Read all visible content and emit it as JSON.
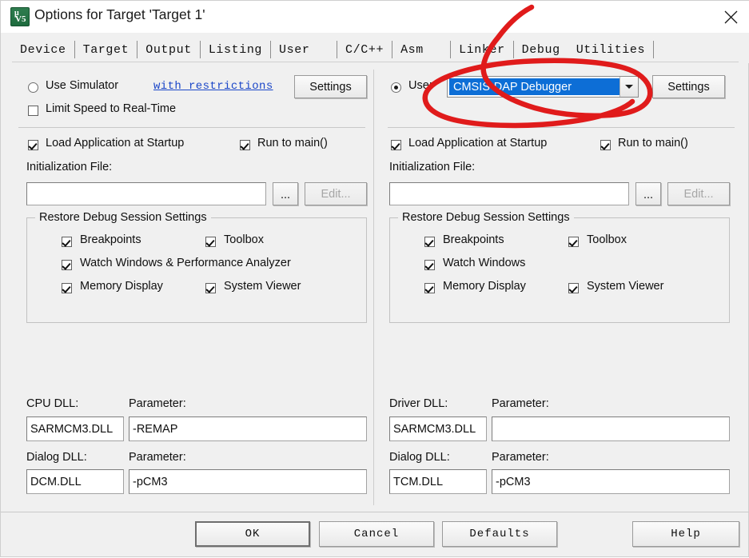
{
  "window": {
    "title": "Options for Target 'Target 1'",
    "app_icon": "uvision-icon",
    "icon_glyph_top": "μ",
    "icon_glyph_bottom": "V5",
    "close_label": "✕"
  },
  "tabs": [
    {
      "label": "Device",
      "active": false
    },
    {
      "label": "Target",
      "active": false
    },
    {
      "label": "Output",
      "active": false
    },
    {
      "label": "Listing",
      "active": false
    },
    {
      "label": "User",
      "active": false
    },
    {
      "label": "C/C++",
      "active": false
    },
    {
      "label": "Asm",
      "active": false
    },
    {
      "label": "Linker",
      "active": false
    },
    {
      "label": "Debug",
      "active": true
    },
    {
      "label": "Utilities",
      "active": false
    }
  ],
  "left_panel": {
    "mode_radio": {
      "label": "Use Simulator",
      "checked": false
    },
    "restrictions_link": "with restrictions",
    "settings_button": "Settings",
    "limit_speed": {
      "label": "Limit Speed to Real-Time",
      "checked": false
    },
    "load_app": {
      "label": "Load Application at Startup",
      "checked": true
    },
    "run_to_main": {
      "label": "Run to main()",
      "checked": true
    },
    "init_file_label": "Initialization File:",
    "init_file_value": "",
    "browse_button": "...",
    "edit_button": "Edit...",
    "restore_group": {
      "title": "Restore Debug Session Settings",
      "items": [
        {
          "label": "Breakpoints",
          "checked": true
        },
        {
          "label": "Toolbox",
          "checked": true
        },
        {
          "label": "Watch Windows & Performance Analyzer",
          "checked": true
        },
        {
          "label": "Memory Display",
          "checked": true
        },
        {
          "label": "System Viewer",
          "checked": true
        }
      ]
    },
    "dll": {
      "cpu_dll_label": "CPU DLL:",
      "cpu_dll_value": "SARMCM3.DLL",
      "cpu_param_label": "Parameter:",
      "cpu_param_value": "-REMAP",
      "dialog_dll_label": "Dialog DLL:",
      "dialog_dll_value": "DCM.DLL",
      "dialog_param_label": "Parameter:",
      "dialog_param_value": "-pCM3"
    }
  },
  "right_panel": {
    "mode_radio": {
      "label": "Use:",
      "checked": true
    },
    "debugger_select": {
      "value": "CMSIS-DAP Debugger",
      "options": [
        "CMSIS-DAP Debugger"
      ]
    },
    "settings_button": "Settings",
    "load_app": {
      "label": "Load Application at Startup",
      "checked": true
    },
    "run_to_main": {
      "label": "Run to main()",
      "checked": true
    },
    "init_file_label": "Initialization File:",
    "init_file_value": "",
    "browse_button": "...",
    "edit_button": "Edit...",
    "restore_group": {
      "title": "Restore Debug Session Settings",
      "items": [
        {
          "label": "Breakpoints",
          "checked": true
        },
        {
          "label": "Toolbox",
          "checked": true
        },
        {
          "label": "Watch Windows",
          "checked": true
        },
        {
          "label": "Memory Display",
          "checked": true
        },
        {
          "label": "System Viewer",
          "checked": true
        }
      ]
    },
    "dll": {
      "driver_dll_label": "Driver DLL:",
      "driver_dll_value": "SARMCM3.DLL",
      "driver_param_label": "Parameter:",
      "driver_param_value": "",
      "dialog_dll_label": "Dialog DLL:",
      "dialog_dll_value": "TCM.DLL",
      "dialog_param_label": "Parameter:",
      "dialog_param_value": "-pCM3"
    }
  },
  "footer": {
    "ok": "OK",
    "cancel": "Cancel",
    "defaults": "Defaults",
    "help": "Help"
  },
  "annotation": {
    "color": "#e01b1b",
    "shape": "hand-drawn-loop-around-debugger-dropdown"
  }
}
